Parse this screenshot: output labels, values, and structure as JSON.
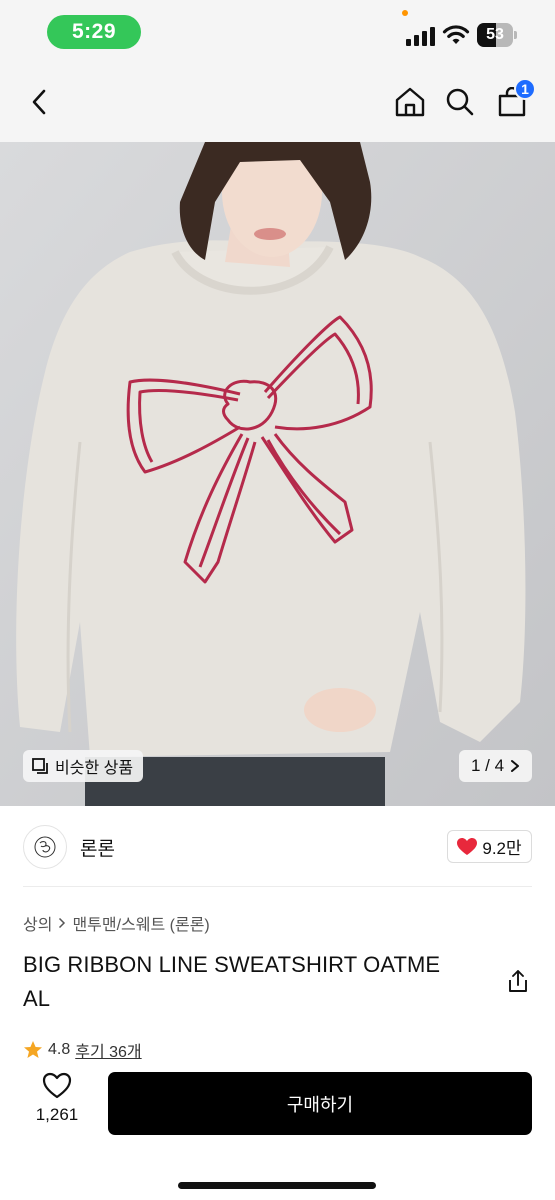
{
  "status_bar": {
    "time": "5:29",
    "battery_level": "53",
    "battery_fraction": 0.53,
    "icons": [
      "signal-icon",
      "wifi-icon",
      "battery-icon"
    ],
    "time_pill_color": "#34c759"
  },
  "nav": {
    "icons": [
      "back-icon",
      "home-icon",
      "search-icon",
      "cart-icon"
    ],
    "cart_badge": "1",
    "badge_color": "#1e6cff"
  },
  "image": {
    "similar_label": "비슷한 상품",
    "counter": "1 / 4",
    "description_icon": "copy-icon"
  },
  "brand": {
    "name": "론론",
    "likes": "9.2만",
    "heart_color": "#e8283c"
  },
  "product": {
    "breadcrumb": [
      "상의",
      "맨투맨/스웨트 (론론)"
    ],
    "title": "BIG RIBBON LINE SWEATSHIRT OATMEAL",
    "title_line1": "BIG RIBBON LINE SWEATSHIRT OATME",
    "title_line2": "AL",
    "rating": "4.8",
    "review_text": "후기 36개",
    "star_color": "#f5a623"
  },
  "bottom": {
    "wish_count": "1,261",
    "buy_label": "구매하기"
  }
}
